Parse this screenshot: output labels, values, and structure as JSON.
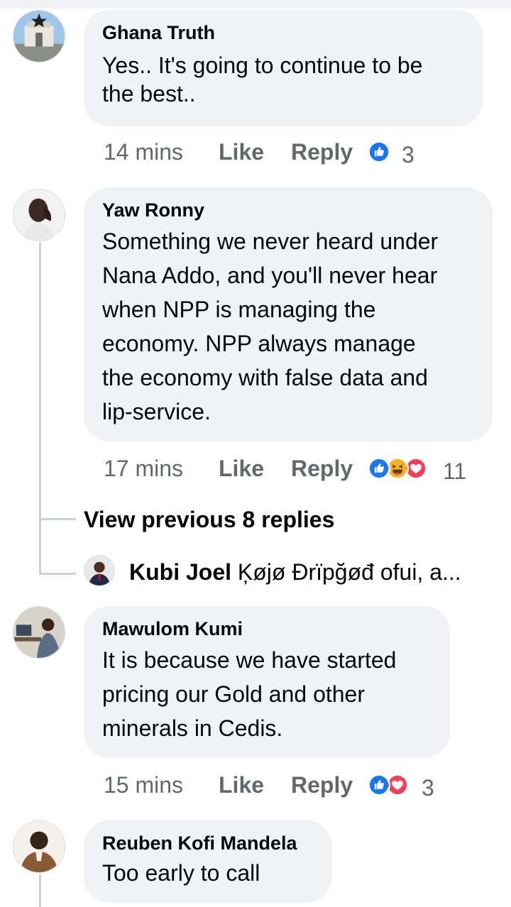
{
  "comments": [
    {
      "author": "Ghana Truth",
      "lines": [
        "Yes.. It's going to continue to be",
        "the best.."
      ],
      "time": "14 mins",
      "like": "Like",
      "reply": "Reply",
      "reactions": [
        "like-reaction-icon"
      ],
      "reaction_count": "3"
    },
    {
      "author": "Yaw Ronny",
      "lines": [
        "Something we never heard under",
        "Nana Addo, and you'll never hear",
        "when NPP is managing the",
        "economy. NPP always manage",
        "the economy with false data and",
        "lip-service."
      ],
      "time": "17 mins",
      "like": "Like",
      "reply": "Reply",
      "reactions": [
        "like-reaction-icon",
        "haha-reaction-icon",
        "love-reaction-icon"
      ],
      "reaction_count": "11",
      "replies": {
        "view_previous": "View previous 8 replies",
        "last_reply": {
          "author": "Kubi Joel",
          "snippet": "Ķøjø Đrïpğøđ ofui, a..."
        }
      }
    },
    {
      "author": "Mawulom Kumi",
      "lines": [
        "It is because we have started",
        "pricing our Gold and other",
        "minerals in Cedis."
      ],
      "time": "15 mins",
      "like": "Like",
      "reply": "Reply",
      "reactions": [
        "like-reaction-icon",
        "love-reaction-icon"
      ],
      "reaction_count": "3"
    },
    {
      "author": "Reuben Kofi Mandela",
      "lines": [
        "Too early to call"
      ]
    }
  ],
  "colors": {
    "bubble": "#f0f2f5",
    "meta": "#65676b",
    "like_blue": "#1877f2",
    "love_red": "#f33e58",
    "haha_yellow": "#f7b125"
  }
}
